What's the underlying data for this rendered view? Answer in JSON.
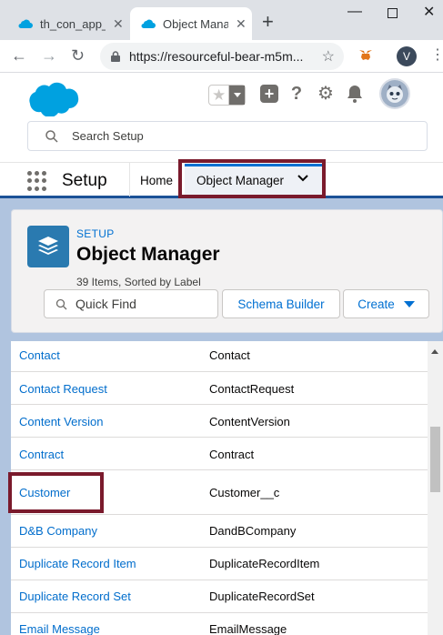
{
  "browser": {
    "tabs": [
      {
        "label": "th_con_app_",
        "close": "✕",
        "active": false
      },
      {
        "label": "Object Mana",
        "close": "✕",
        "active": true
      }
    ],
    "new_tab": "+",
    "url": "https://resourceful-bear-m5m...",
    "profile_initial": "V"
  },
  "colors": {
    "brand_blue": "#00a1e0",
    "link": "#006dcc",
    "highlight_box": "#7a1a2c",
    "object_icon": "#2a7ab0"
  },
  "header": {
    "search_placeholder": "Search Setup"
  },
  "navbar": {
    "app_name": "Setup",
    "home_label": "Home",
    "object_manager_label": "Object Manager"
  },
  "object_manager": {
    "kicker": "SETUP",
    "title": "Object Manager",
    "meta": "39 Items, Sorted by Label",
    "quick_find_placeholder": "Quick Find",
    "schema_builder_label": "Schema Builder",
    "create_label": "Create"
  },
  "table": {
    "rows": [
      {
        "label": "Contact",
        "api_name": "Contact"
      },
      {
        "label": "Contact Request",
        "api_name": "ContactRequest"
      },
      {
        "label": "Content Version",
        "api_name": "ContentVersion"
      },
      {
        "label": "Contract",
        "api_name": "Contract"
      },
      {
        "label": "Customer",
        "api_name": "Customer__c"
      },
      {
        "label": "D&B Company",
        "api_name": "DandBCompany"
      },
      {
        "label": "Duplicate Record Item",
        "api_name": "DuplicateRecordItem"
      },
      {
        "label": "Duplicate Record Set",
        "api_name": "DuplicateRecordSet"
      },
      {
        "label": "Email Message",
        "api_name": "EmailMessage"
      }
    ]
  }
}
